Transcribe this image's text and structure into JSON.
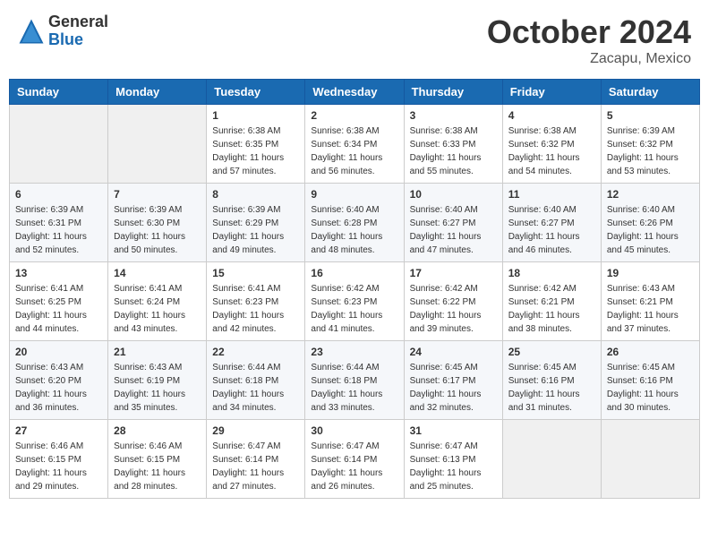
{
  "header": {
    "logo_general": "General",
    "logo_blue": "Blue",
    "month_title": "October 2024",
    "location": "Zacapu, Mexico"
  },
  "days_of_week": [
    "Sunday",
    "Monday",
    "Tuesday",
    "Wednesday",
    "Thursday",
    "Friday",
    "Saturday"
  ],
  "weeks": [
    [
      {
        "day": "",
        "info": ""
      },
      {
        "day": "",
        "info": ""
      },
      {
        "day": "1",
        "sunrise": "Sunrise: 6:38 AM",
        "sunset": "Sunset: 6:35 PM",
        "daylight": "Daylight: 11 hours and 57 minutes."
      },
      {
        "day": "2",
        "sunrise": "Sunrise: 6:38 AM",
        "sunset": "Sunset: 6:34 PM",
        "daylight": "Daylight: 11 hours and 56 minutes."
      },
      {
        "day": "3",
        "sunrise": "Sunrise: 6:38 AM",
        "sunset": "Sunset: 6:33 PM",
        "daylight": "Daylight: 11 hours and 55 minutes."
      },
      {
        "day": "4",
        "sunrise": "Sunrise: 6:38 AM",
        "sunset": "Sunset: 6:32 PM",
        "daylight": "Daylight: 11 hours and 54 minutes."
      },
      {
        "day": "5",
        "sunrise": "Sunrise: 6:39 AM",
        "sunset": "Sunset: 6:32 PM",
        "daylight": "Daylight: 11 hours and 53 minutes."
      }
    ],
    [
      {
        "day": "6",
        "sunrise": "Sunrise: 6:39 AM",
        "sunset": "Sunset: 6:31 PM",
        "daylight": "Daylight: 11 hours and 52 minutes."
      },
      {
        "day": "7",
        "sunrise": "Sunrise: 6:39 AM",
        "sunset": "Sunset: 6:30 PM",
        "daylight": "Daylight: 11 hours and 50 minutes."
      },
      {
        "day": "8",
        "sunrise": "Sunrise: 6:39 AM",
        "sunset": "Sunset: 6:29 PM",
        "daylight": "Daylight: 11 hours and 49 minutes."
      },
      {
        "day": "9",
        "sunrise": "Sunrise: 6:40 AM",
        "sunset": "Sunset: 6:28 PM",
        "daylight": "Daylight: 11 hours and 48 minutes."
      },
      {
        "day": "10",
        "sunrise": "Sunrise: 6:40 AM",
        "sunset": "Sunset: 6:27 PM",
        "daylight": "Daylight: 11 hours and 47 minutes."
      },
      {
        "day": "11",
        "sunrise": "Sunrise: 6:40 AM",
        "sunset": "Sunset: 6:27 PM",
        "daylight": "Daylight: 11 hours and 46 minutes."
      },
      {
        "day": "12",
        "sunrise": "Sunrise: 6:40 AM",
        "sunset": "Sunset: 6:26 PM",
        "daylight": "Daylight: 11 hours and 45 minutes."
      }
    ],
    [
      {
        "day": "13",
        "sunrise": "Sunrise: 6:41 AM",
        "sunset": "Sunset: 6:25 PM",
        "daylight": "Daylight: 11 hours and 44 minutes."
      },
      {
        "day": "14",
        "sunrise": "Sunrise: 6:41 AM",
        "sunset": "Sunset: 6:24 PM",
        "daylight": "Daylight: 11 hours and 43 minutes."
      },
      {
        "day": "15",
        "sunrise": "Sunrise: 6:41 AM",
        "sunset": "Sunset: 6:23 PM",
        "daylight": "Daylight: 11 hours and 42 minutes."
      },
      {
        "day": "16",
        "sunrise": "Sunrise: 6:42 AM",
        "sunset": "Sunset: 6:23 PM",
        "daylight": "Daylight: 11 hours and 41 minutes."
      },
      {
        "day": "17",
        "sunrise": "Sunrise: 6:42 AM",
        "sunset": "Sunset: 6:22 PM",
        "daylight": "Daylight: 11 hours and 39 minutes."
      },
      {
        "day": "18",
        "sunrise": "Sunrise: 6:42 AM",
        "sunset": "Sunset: 6:21 PM",
        "daylight": "Daylight: 11 hours and 38 minutes."
      },
      {
        "day": "19",
        "sunrise": "Sunrise: 6:43 AM",
        "sunset": "Sunset: 6:21 PM",
        "daylight": "Daylight: 11 hours and 37 minutes."
      }
    ],
    [
      {
        "day": "20",
        "sunrise": "Sunrise: 6:43 AM",
        "sunset": "Sunset: 6:20 PM",
        "daylight": "Daylight: 11 hours and 36 minutes."
      },
      {
        "day": "21",
        "sunrise": "Sunrise: 6:43 AM",
        "sunset": "Sunset: 6:19 PM",
        "daylight": "Daylight: 11 hours and 35 minutes."
      },
      {
        "day": "22",
        "sunrise": "Sunrise: 6:44 AM",
        "sunset": "Sunset: 6:18 PM",
        "daylight": "Daylight: 11 hours and 34 minutes."
      },
      {
        "day": "23",
        "sunrise": "Sunrise: 6:44 AM",
        "sunset": "Sunset: 6:18 PM",
        "daylight": "Daylight: 11 hours and 33 minutes."
      },
      {
        "day": "24",
        "sunrise": "Sunrise: 6:45 AM",
        "sunset": "Sunset: 6:17 PM",
        "daylight": "Daylight: 11 hours and 32 minutes."
      },
      {
        "day": "25",
        "sunrise": "Sunrise: 6:45 AM",
        "sunset": "Sunset: 6:16 PM",
        "daylight": "Daylight: 11 hours and 31 minutes."
      },
      {
        "day": "26",
        "sunrise": "Sunrise: 6:45 AM",
        "sunset": "Sunset: 6:16 PM",
        "daylight": "Daylight: 11 hours and 30 minutes."
      }
    ],
    [
      {
        "day": "27",
        "sunrise": "Sunrise: 6:46 AM",
        "sunset": "Sunset: 6:15 PM",
        "daylight": "Daylight: 11 hours and 29 minutes."
      },
      {
        "day": "28",
        "sunrise": "Sunrise: 6:46 AM",
        "sunset": "Sunset: 6:15 PM",
        "daylight": "Daylight: 11 hours and 28 minutes."
      },
      {
        "day": "29",
        "sunrise": "Sunrise: 6:47 AM",
        "sunset": "Sunset: 6:14 PM",
        "daylight": "Daylight: 11 hours and 27 minutes."
      },
      {
        "day": "30",
        "sunrise": "Sunrise: 6:47 AM",
        "sunset": "Sunset: 6:14 PM",
        "daylight": "Daylight: 11 hours and 26 minutes."
      },
      {
        "day": "31",
        "sunrise": "Sunrise: 6:47 AM",
        "sunset": "Sunset: 6:13 PM",
        "daylight": "Daylight: 11 hours and 25 minutes."
      },
      {
        "day": "",
        "info": ""
      },
      {
        "day": "",
        "info": ""
      }
    ]
  ]
}
